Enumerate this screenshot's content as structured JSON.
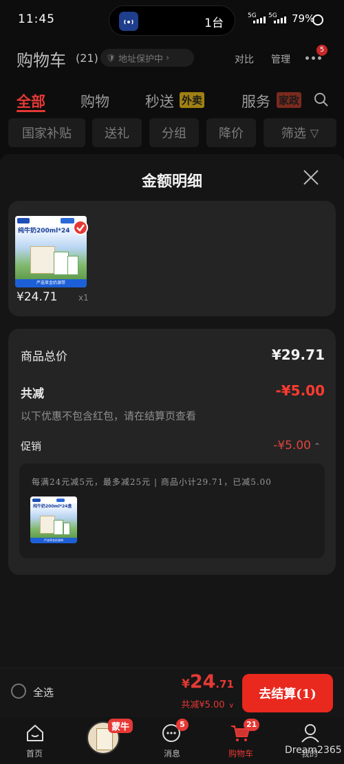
{
  "status_bar": {
    "time": "11:45",
    "island_count": "1台",
    "nfc_badge": "1",
    "net1": "5G",
    "net2": "5G",
    "battery": "79%"
  },
  "header": {
    "title": "购物车",
    "count": "(21)",
    "address_protection": "地址保护中",
    "compare": "对比",
    "manage": "管理",
    "more_badge": "5"
  },
  "tabs": [
    {
      "label": "全部",
      "active": true
    },
    {
      "label": "购物"
    },
    {
      "label": "秒送",
      "tag": "外卖"
    },
    {
      "label": "服务",
      "tag": "家政"
    }
  ],
  "filters": [
    "国家补贴",
    "送礼",
    "分组",
    "降价",
    "筛选"
  ],
  "sheet": {
    "title": "金额明细",
    "item": {
      "product_title": "纯牛奶200ml*24",
      "product_banner": "严选草金奶源带",
      "price": "¥24.71",
      "qty": "x1"
    },
    "breakdown": {
      "total_label": "商品总价",
      "total_value": "¥29.71",
      "discount_label": "共减",
      "discount_value": "-¥5.00",
      "note": "以下优惠不包含红包，请在结算页查看",
      "promo_label": "促销",
      "promo_value": "-¥5.00",
      "promo_desc": "每满24元减5元，最多减25元 | 商品小计29.71，已减5.00",
      "promo_thumb_title": "纯牛奶200ml*24盒"
    }
  },
  "checkout": {
    "select_all": "全选",
    "yen": "¥",
    "total_int": "24",
    "total_dec": ".71",
    "saved": "共减¥5.00",
    "pay_label": "去结算(1)"
  },
  "nav": [
    {
      "label": "首页"
    },
    {
      "label": "蒙牛",
      "brand": true
    },
    {
      "label": "消息",
      "badge": "5"
    },
    {
      "label": "购物车",
      "badge": "21",
      "active": true
    },
    {
      "label": "我的"
    }
  ],
  "watermark": "Dream2365",
  "colors": {
    "accent": "#e53935",
    "bg": "#0d0d0d",
    "card": "#242424"
  }
}
